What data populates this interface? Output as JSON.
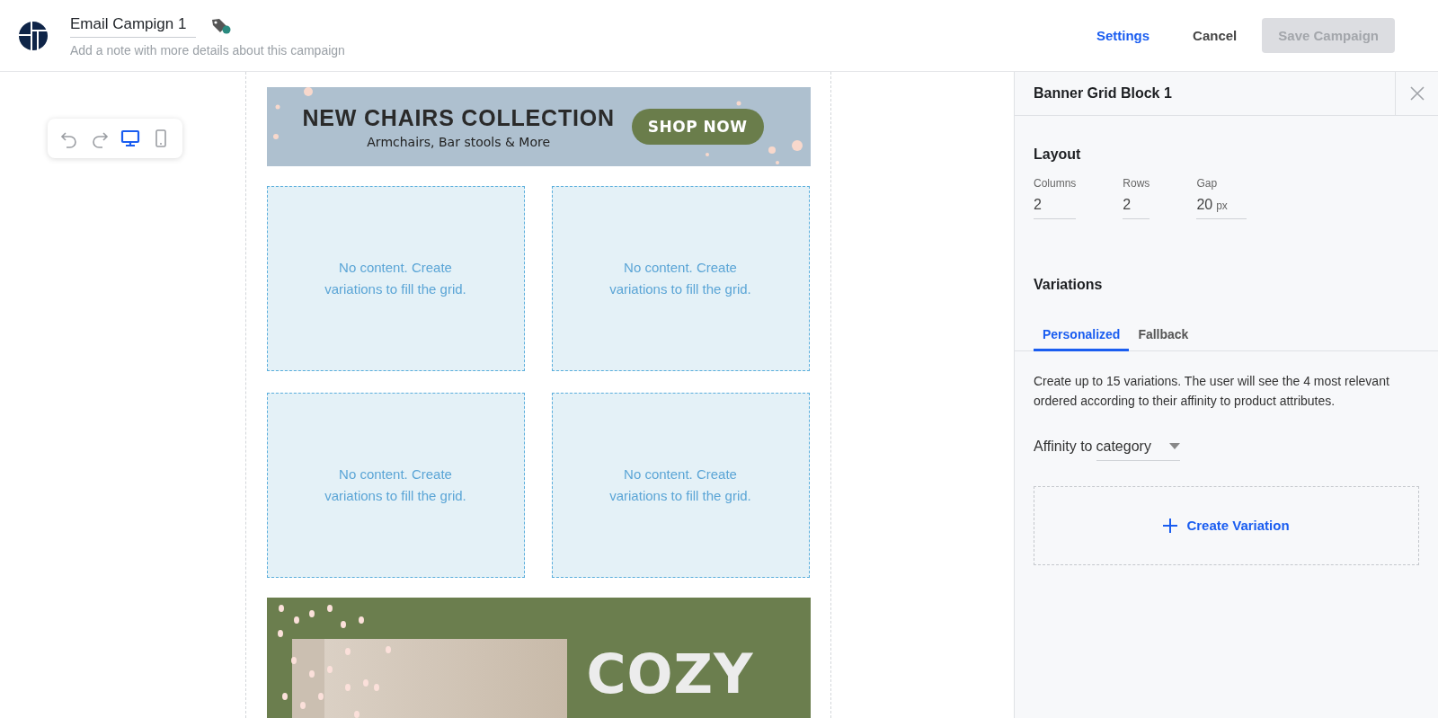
{
  "header": {
    "title": "Email Campign 1",
    "note_placeholder": "Add a note with more details about this campaign",
    "actions": [
      {
        "label": "Settings",
        "kind": "link",
        "disabled": false
      },
      {
        "label": "Cancel",
        "kind": "plain",
        "disabled": false
      },
      {
        "label": "Save Campaign",
        "kind": "primary",
        "disabled": true
      }
    ]
  },
  "device_toolbar": [
    {
      "kind": "undo",
      "selected": false
    },
    {
      "kind": "redo",
      "selected": false
    },
    {
      "kind": "desktop",
      "selected": true
    },
    {
      "kind": "mobile",
      "selected": false
    }
  ],
  "email": {
    "top_banner": {
      "heading": "NEW CHAIRS COLLECTION",
      "subheading": "Armchairs, Bar stools & More",
      "button": "SHOP NOW"
    },
    "grid": {
      "cells": [
        {
          "text": "No content. Create variations to fill the grid."
        },
        {
          "text": "No content. Create variations to fill the grid."
        },
        {
          "text": "No content. Create variations to fill the grid."
        },
        {
          "text": "No content. Create variations to fill the grid."
        }
      ]
    },
    "bottom_banner": {
      "kind": "picture",
      "heading_lines": [
        "COZY"
      ]
    }
  },
  "panel": {
    "title": "Banner Grid Block 1",
    "layout": {
      "heading": "Layout",
      "fields": [
        {
          "label": "Columns",
          "value": "2"
        },
        {
          "label": "Rows",
          "value": "2"
        },
        {
          "label": "Gap",
          "value": "20",
          "unit": "px"
        }
      ]
    },
    "variations": {
      "heading": "Variations",
      "tabs": [
        {
          "label": "Personalized",
          "selected": true
        },
        {
          "label": "Fallback",
          "selected": false
        }
      ],
      "description": "Create up to 15 variations. The user will see the 4 most relevant ordered according to their affinity to product attributes.",
      "sort_select": {
        "label": "Affinity to",
        "value": "category"
      },
      "create_button": "Create Variation"
    }
  }
}
